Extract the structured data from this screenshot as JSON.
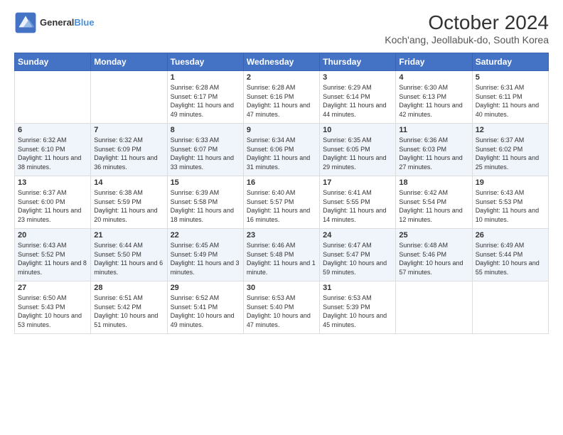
{
  "logo": {
    "line1": "General",
    "line2": "Blue"
  },
  "title": "October 2024",
  "subtitle": "Koch'ang, Jeollabuk-do, South Korea",
  "days_of_week": [
    "Sunday",
    "Monday",
    "Tuesday",
    "Wednesday",
    "Thursday",
    "Friday",
    "Saturday"
  ],
  "weeks": [
    [
      {
        "day": "",
        "content": ""
      },
      {
        "day": "",
        "content": ""
      },
      {
        "day": "1",
        "content": "Sunrise: 6:28 AM\nSunset: 6:17 PM\nDaylight: 11 hours and 49 minutes."
      },
      {
        "day": "2",
        "content": "Sunrise: 6:28 AM\nSunset: 6:16 PM\nDaylight: 11 hours and 47 minutes."
      },
      {
        "day": "3",
        "content": "Sunrise: 6:29 AM\nSunset: 6:14 PM\nDaylight: 11 hours and 44 minutes."
      },
      {
        "day": "4",
        "content": "Sunrise: 6:30 AM\nSunset: 6:13 PM\nDaylight: 11 hours and 42 minutes."
      },
      {
        "day": "5",
        "content": "Sunrise: 6:31 AM\nSunset: 6:11 PM\nDaylight: 11 hours and 40 minutes."
      }
    ],
    [
      {
        "day": "6",
        "content": "Sunrise: 6:32 AM\nSunset: 6:10 PM\nDaylight: 11 hours and 38 minutes."
      },
      {
        "day": "7",
        "content": "Sunrise: 6:32 AM\nSunset: 6:09 PM\nDaylight: 11 hours and 36 minutes."
      },
      {
        "day": "8",
        "content": "Sunrise: 6:33 AM\nSunset: 6:07 PM\nDaylight: 11 hours and 33 minutes."
      },
      {
        "day": "9",
        "content": "Sunrise: 6:34 AM\nSunset: 6:06 PM\nDaylight: 11 hours and 31 minutes."
      },
      {
        "day": "10",
        "content": "Sunrise: 6:35 AM\nSunset: 6:05 PM\nDaylight: 11 hours and 29 minutes."
      },
      {
        "day": "11",
        "content": "Sunrise: 6:36 AM\nSunset: 6:03 PM\nDaylight: 11 hours and 27 minutes."
      },
      {
        "day": "12",
        "content": "Sunrise: 6:37 AM\nSunset: 6:02 PM\nDaylight: 11 hours and 25 minutes."
      }
    ],
    [
      {
        "day": "13",
        "content": "Sunrise: 6:37 AM\nSunset: 6:00 PM\nDaylight: 11 hours and 23 minutes."
      },
      {
        "day": "14",
        "content": "Sunrise: 6:38 AM\nSunset: 5:59 PM\nDaylight: 11 hours and 20 minutes."
      },
      {
        "day": "15",
        "content": "Sunrise: 6:39 AM\nSunset: 5:58 PM\nDaylight: 11 hours and 18 minutes."
      },
      {
        "day": "16",
        "content": "Sunrise: 6:40 AM\nSunset: 5:57 PM\nDaylight: 11 hours and 16 minutes."
      },
      {
        "day": "17",
        "content": "Sunrise: 6:41 AM\nSunset: 5:55 PM\nDaylight: 11 hours and 14 minutes."
      },
      {
        "day": "18",
        "content": "Sunrise: 6:42 AM\nSunset: 5:54 PM\nDaylight: 11 hours and 12 minutes."
      },
      {
        "day": "19",
        "content": "Sunrise: 6:43 AM\nSunset: 5:53 PM\nDaylight: 11 hours and 10 minutes."
      }
    ],
    [
      {
        "day": "20",
        "content": "Sunrise: 6:43 AM\nSunset: 5:52 PM\nDaylight: 11 hours and 8 minutes."
      },
      {
        "day": "21",
        "content": "Sunrise: 6:44 AM\nSunset: 5:50 PM\nDaylight: 11 hours and 6 minutes."
      },
      {
        "day": "22",
        "content": "Sunrise: 6:45 AM\nSunset: 5:49 PM\nDaylight: 11 hours and 3 minutes."
      },
      {
        "day": "23",
        "content": "Sunrise: 6:46 AM\nSunset: 5:48 PM\nDaylight: 11 hours and 1 minute."
      },
      {
        "day": "24",
        "content": "Sunrise: 6:47 AM\nSunset: 5:47 PM\nDaylight: 10 hours and 59 minutes."
      },
      {
        "day": "25",
        "content": "Sunrise: 6:48 AM\nSunset: 5:46 PM\nDaylight: 10 hours and 57 minutes."
      },
      {
        "day": "26",
        "content": "Sunrise: 6:49 AM\nSunset: 5:44 PM\nDaylight: 10 hours and 55 minutes."
      }
    ],
    [
      {
        "day": "27",
        "content": "Sunrise: 6:50 AM\nSunset: 5:43 PM\nDaylight: 10 hours and 53 minutes."
      },
      {
        "day": "28",
        "content": "Sunrise: 6:51 AM\nSunset: 5:42 PM\nDaylight: 10 hours and 51 minutes."
      },
      {
        "day": "29",
        "content": "Sunrise: 6:52 AM\nSunset: 5:41 PM\nDaylight: 10 hours and 49 minutes."
      },
      {
        "day": "30",
        "content": "Sunrise: 6:53 AM\nSunset: 5:40 PM\nDaylight: 10 hours and 47 minutes."
      },
      {
        "day": "31",
        "content": "Sunrise: 6:53 AM\nSunset: 5:39 PM\nDaylight: 10 hours and 45 minutes."
      },
      {
        "day": "",
        "content": ""
      },
      {
        "day": "",
        "content": ""
      }
    ]
  ]
}
